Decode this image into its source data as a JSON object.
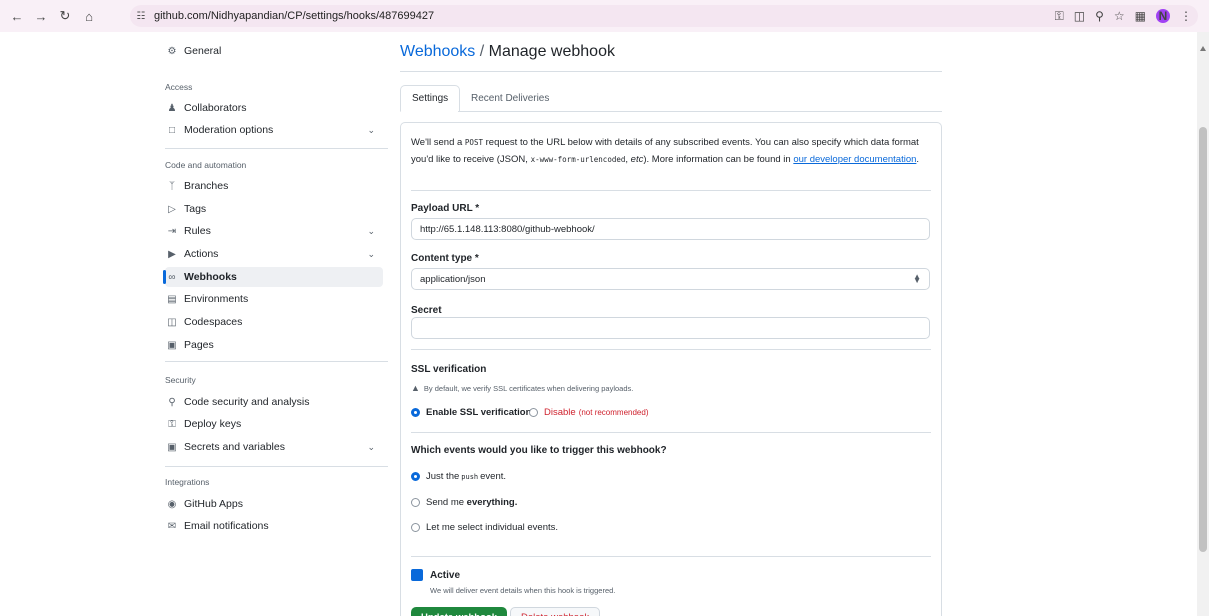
{
  "browser": {
    "url": "github.com/Nidhyapandian/CP/settings/hooks/487699427",
    "avatar_initial": "N",
    "icons": [
      "back-icon",
      "forward-icon",
      "reload-icon",
      "home-icon",
      "site-info-icon",
      "password-key-icon",
      "cast-icon",
      "zoom-icon",
      "bookmark-star-icon",
      "extensions-icon",
      "menu-dots-icon"
    ]
  },
  "sidebar": {
    "general": "General",
    "access_heading": "Access",
    "collaborators": "Collaborators",
    "moderation": "Moderation options",
    "code_heading": "Code and automation",
    "branches": "Branches",
    "tags": "Tags",
    "rules": "Rules",
    "actions": "Actions",
    "webhooks": "Webhooks",
    "environments": "Environments",
    "codespaces": "Codespaces",
    "pages": "Pages",
    "security_heading": "Security",
    "code_security": "Code security and analysis",
    "deploy_keys": "Deploy keys",
    "secrets": "Secrets and variables",
    "integrations_heading": "Integrations",
    "github_apps": "GitHub Apps",
    "email_notifications": "Email notifications"
  },
  "main": {
    "breadcrumb": "Webhooks",
    "separator": " / ",
    "title": "Manage webhook",
    "tabs": [
      {
        "label": "Settings",
        "selected": true
      },
      {
        "label": "Recent Deliveries",
        "selected": false
      }
    ],
    "intro": {
      "part1": "We'll send a ",
      "post": "POST",
      "part2": " request to the URL below with details of any subscribed events. You can also specify which data format you'd like to receive (JSON, ",
      "form": "x-www-form-urlencoded",
      "part3": ", ",
      "etc": "etc",
      "part4": "). More information can be found in ",
      "link": "our developer documentation",
      "part5": "."
    },
    "payload_label": "Payload URL *",
    "payload_value": "http://65.1.148.113:8080/github-webhook/",
    "content_type_label": "Content type *",
    "content_type_value": "application/json",
    "secret_label": "Secret",
    "secret_value": "",
    "ssl_label": "SSL verification",
    "ssl_hint": "By default, we verify SSL certificates when delivering payloads.",
    "ssl_enable": "Enable SSL verification",
    "ssl_disable": "Disable",
    "ssl_disable_note": "(not recommended)",
    "events_label": "Which events would you like to trigger this webhook?",
    "event_push_a": "Just the",
    "event_push_code": "push",
    "event_push_b": "event.",
    "event_all_a": "Send me",
    "event_all_b": "everything.",
    "event_select": "Let me select individual events.",
    "active_label": "Active",
    "active_hint": "We will deliver event details when this hook is triggered.",
    "update_button": "Update webhook",
    "delete_button": "Delete webhook"
  },
  "colors": {
    "accent": "#0969da",
    "primary_button": "#1f883d",
    "danger": "#cf222e"
  }
}
